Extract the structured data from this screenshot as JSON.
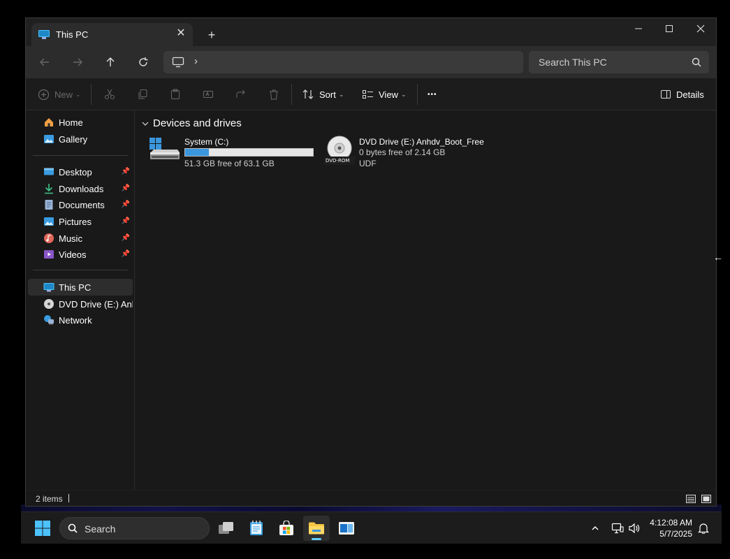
{
  "window": {
    "tab_title": "This PC",
    "new_tab_symbol": "+",
    "close_symbol": "✕"
  },
  "navbar": {
    "address_separator": "›",
    "search_placeholder": "Search This PC"
  },
  "toolbar": {
    "new_label": "New",
    "sort_label": "Sort",
    "view_label": "View",
    "more_label": "•••",
    "details_label": "Details"
  },
  "sidebar": {
    "items": [
      {
        "label": "Home",
        "icon": "home-icon"
      },
      {
        "label": "Gallery",
        "icon": "gallery-icon"
      },
      {
        "label": "Desktop",
        "icon": "desktop-icon",
        "pinned": true
      },
      {
        "label": "Downloads",
        "icon": "downloads-icon",
        "pinned": true
      },
      {
        "label": "Documents",
        "icon": "documents-icon",
        "pinned": true
      },
      {
        "label": "Pictures",
        "icon": "pictures-icon",
        "pinned": true
      },
      {
        "label": "Music",
        "icon": "music-icon",
        "pinned": true
      },
      {
        "label": "Videos",
        "icon": "videos-icon",
        "pinned": true
      },
      {
        "label": "This PC",
        "icon": "this-pc-icon",
        "selected": true
      },
      {
        "label": "DVD Drive (E:) Anhdv",
        "icon": "dvd-icon"
      },
      {
        "label": "Network",
        "icon": "network-icon"
      }
    ]
  },
  "content": {
    "section_title": "Devices and drives",
    "drives": [
      {
        "name": "System (C:)",
        "free_text": "51.3 GB free of 63.1 GB",
        "used_fraction": 0.187
      },
      {
        "name": "DVD Drive (E:) Anhdv_Boot_Free",
        "free_text": "0 bytes free of 2.14 GB",
        "filesystem": "UDF",
        "icon_label": "DVD-ROM"
      }
    ]
  },
  "statusbar": {
    "item_count": "2 items"
  },
  "taskbar": {
    "search_label": "Search",
    "time": "4:12:08 AM",
    "date": "5/7/2025"
  },
  "colors": {
    "accent": "#3a96dd",
    "window_bg": "#191919",
    "taskbar_bg": "#1c1c1c"
  }
}
